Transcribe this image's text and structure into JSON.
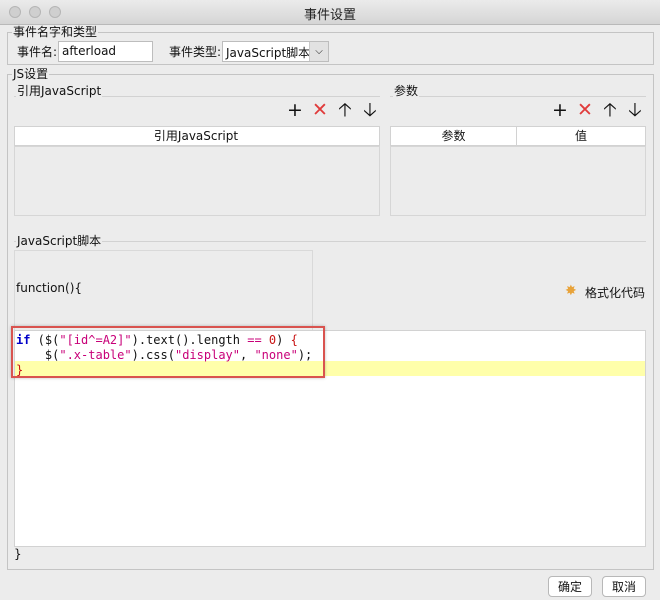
{
  "window": {
    "title": "事件设置"
  },
  "event_section": {
    "legend": "事件名字和类型",
    "name_label": "事件名:",
    "name_value": "afterload",
    "type_label": "事件类型:",
    "type_value": "JavaScript脚本"
  },
  "js_section": {
    "legend": "JS设置",
    "ref_js": {
      "legend": "引用JavaScript",
      "column": "引用JavaScript"
    },
    "params": {
      "legend": "参数",
      "col_param": "参数",
      "col_value": "值"
    },
    "toolbar_icons": [
      "plus-icon",
      "delete-icon",
      "arrow-up-icon",
      "arrow-down-icon"
    ],
    "script": {
      "legend": "JavaScript脚本",
      "func_header": "function(){",
      "format_label": "格式化代码",
      "closing": "}"
    }
  },
  "code_lines": [
    [
      [
        "kw",
        "if"
      ],
      [
        "p",
        " ("
      ],
      [
        "p",
        "$("
      ],
      [
        "st",
        "\"[id^=A2]\""
      ],
      [
        "p",
        ")."
      ],
      [
        "p",
        "text"
      ],
      [
        "p",
        "()"
      ],
      [
        "p",
        ".length "
      ],
      [
        "op",
        "=="
      ],
      [
        "p",
        " "
      ],
      [
        "pn",
        "0"
      ],
      [
        "p",
        ") "
      ],
      [
        "pn",
        "{"
      ]
    ],
    [
      [
        "p",
        "    $("
      ],
      [
        "st",
        "\".x-table\""
      ],
      [
        "p",
        ").css("
      ],
      [
        "st",
        "\"display\""
      ],
      [
        "p",
        ", "
      ],
      [
        "st",
        "\"none\""
      ],
      [
        "p",
        ");"
      ]
    ],
    [
      [
        "pn",
        "}"
      ]
    ]
  ],
  "buttons": {
    "ok": "确定",
    "cancel": "取消"
  }
}
